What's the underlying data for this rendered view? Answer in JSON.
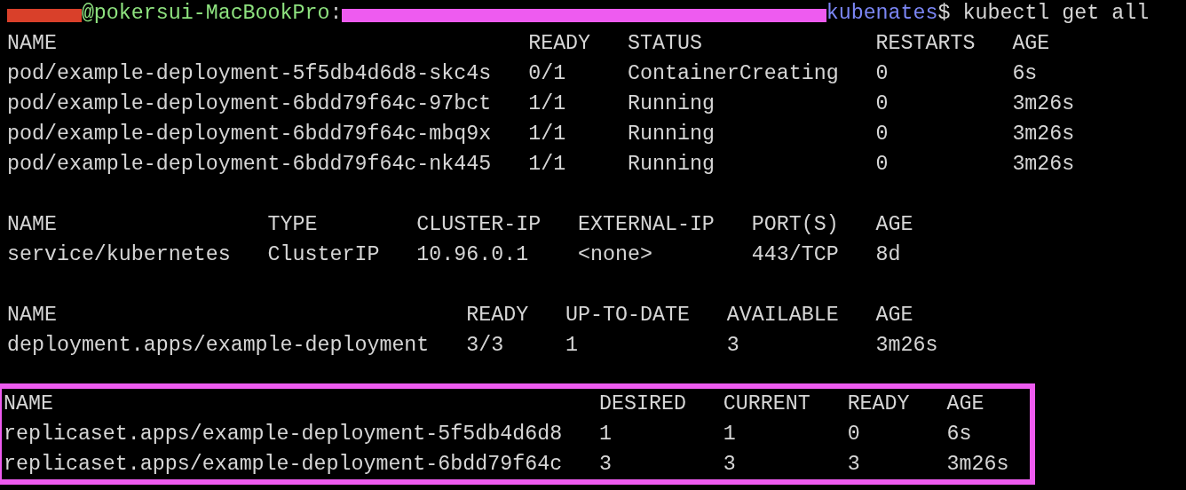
{
  "prompt": [
    {
      "kind": "redaction",
      "color": "#d9402a"
    },
    {
      "kind": "text",
      "text": "@pokersui-MacBookPro",
      "color": "#8ee27f"
    },
    {
      "kind": "text",
      "text": ":",
      "color": "#c8c8c8"
    },
    {
      "kind": "redaction",
      "color": "#ee5bf0"
    },
    {
      "kind": "text",
      "text": "kubenates",
      "color": "#7b86f5"
    },
    {
      "kind": "text",
      "text": "$ kubectl get all",
      "color": "#d6d6d6"
    }
  ],
  "tables": [
    {
      "highlighted": false,
      "columns": [
        "NAME",
        "READY",
        "STATUS",
        "RESTARTS",
        "AGE"
      ],
      "rows": [
        [
          "pod/example-deployment-5f5db4d6d8-skc4s",
          "0/1",
          "ContainerCreating",
          "0",
          "6s"
        ],
        [
          "pod/example-deployment-6bdd79f64c-97bct",
          "1/1",
          "Running",
          "0",
          "3m26s"
        ],
        [
          "pod/example-deployment-6bdd79f64c-mbq9x",
          "1/1",
          "Running",
          "0",
          "3m26s"
        ],
        [
          "pod/example-deployment-6bdd79f64c-nk445",
          "1/1",
          "Running",
          "0",
          "3m26s"
        ]
      ]
    },
    {
      "highlighted": false,
      "columns": [
        "NAME",
        "TYPE",
        "CLUSTER-IP",
        "EXTERNAL-IP",
        "PORT(S)",
        "AGE"
      ],
      "rows": [
        [
          "service/kubernetes",
          "ClusterIP",
          "10.96.0.1",
          "<none>",
          "443/TCP",
          "8d"
        ]
      ]
    },
    {
      "highlighted": false,
      "columns": [
        "NAME",
        "READY",
        "UP-TO-DATE",
        "AVAILABLE",
        "AGE"
      ],
      "rows": [
        [
          "deployment.apps/example-deployment",
          "3/3",
          "1",
          "3",
          "3m26s"
        ]
      ]
    },
    {
      "highlighted": true,
      "columns": [
        "NAME",
        "DESIRED",
        "CURRENT",
        "READY",
        "AGE"
      ],
      "rows": [
        [
          "replicaset.apps/example-deployment-5f5db4d6d8",
          "1",
          "1",
          "0",
          "6s"
        ],
        [
          "replicaset.apps/example-deployment-6bdd79f64c",
          "3",
          "3",
          "3",
          "3m26s"
        ]
      ]
    }
  ]
}
